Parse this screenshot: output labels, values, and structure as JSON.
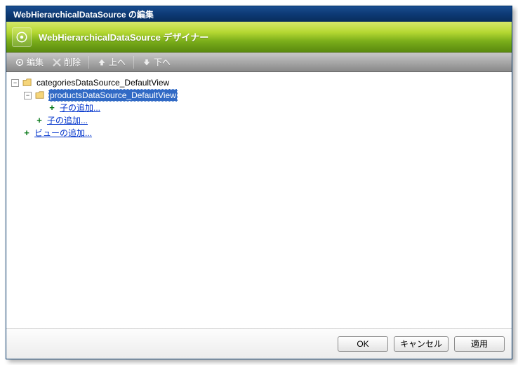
{
  "title": "WebHierarchicalDataSource の編集",
  "designer_title": "WebHierarchicalDataSource デザイナー",
  "toolbar": {
    "edit": "編集",
    "delete": "削除",
    "up": "上へ",
    "down": "下へ"
  },
  "tree": {
    "root_label": "categoriesDataSource_DefaultView",
    "child_label": "productsDataSource_DefaultView",
    "add_child1": "子の追加...",
    "add_child2": "子の追加...",
    "add_view": "ビューの追加..."
  },
  "buttons": {
    "ok": "OK",
    "cancel": "キャンセル",
    "apply": "適用"
  }
}
